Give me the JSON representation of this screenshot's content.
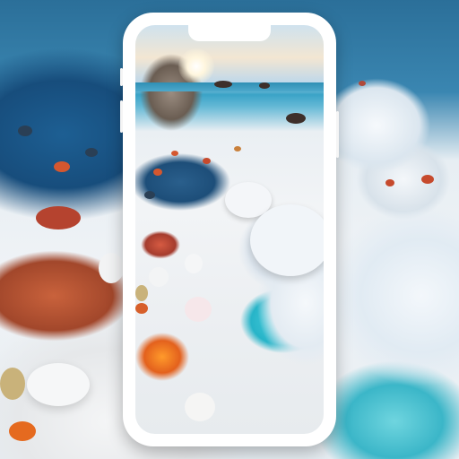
{
  "scene": {
    "type": "wallpaper-preview",
    "device": "phone-mockup",
    "palette": {
      "sand": "#eef1f4",
      "sea": "#27b4c8",
      "shadow_blue": "#1d4e79",
      "pebble_orange": "#e3611d",
      "pebble_red": "#a53c2e",
      "frame": "#ffffff"
    }
  }
}
